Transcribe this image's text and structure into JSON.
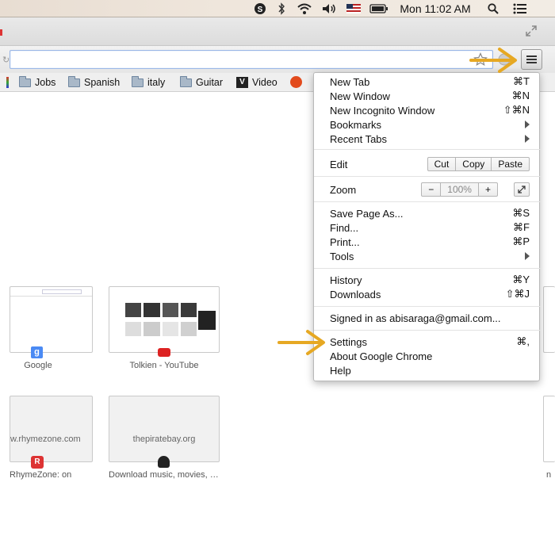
{
  "menubar": {
    "clock": "Mon 11:02 AM"
  },
  "bookmarks": [
    {
      "label": "Jobs"
    },
    {
      "label": "Spanish"
    },
    {
      "label": "italy"
    },
    {
      "label": "Guitar"
    },
    {
      "label": "Video"
    }
  ],
  "thumbnails": [
    {
      "label": "Google"
    },
    {
      "label": "Tolkien - YouTube"
    },
    {
      "label": "RhymeZone: on",
      "site": "w.rhymezone.com"
    },
    {
      "label": "Download music, movies, …",
      "site": "thepiratebay.org"
    },
    {
      "label": "n"
    }
  ],
  "menu": {
    "new_tab": {
      "label": "New Tab",
      "shortcut": "⌘T"
    },
    "new_window": {
      "label": "New Window",
      "shortcut": "⌘N"
    },
    "new_incognito": {
      "label": "New Incognito Window",
      "shortcut": "⇧⌘N"
    },
    "bookmarks": {
      "label": "Bookmarks"
    },
    "recent_tabs": {
      "label": "Recent Tabs"
    },
    "edit": {
      "label": "Edit",
      "cut": "Cut",
      "copy": "Copy",
      "paste": "Paste"
    },
    "zoom": {
      "label": "Zoom",
      "minus": "−",
      "value": "100%",
      "plus": "+"
    },
    "save_page": {
      "label": "Save Page As...",
      "shortcut": "⌘S"
    },
    "find": {
      "label": "Find...",
      "shortcut": "⌘F"
    },
    "print": {
      "label": "Print...",
      "shortcut": "⌘P"
    },
    "tools": {
      "label": "Tools"
    },
    "history": {
      "label": "History",
      "shortcut": "⌘Y"
    },
    "downloads": {
      "label": "Downloads",
      "shortcut": "⇧⌘J"
    },
    "signed_in": {
      "label": "Signed in as abisaraga@gmail.com..."
    },
    "settings": {
      "label": "Settings",
      "shortcut": "⌘,"
    },
    "about": {
      "label": "About Google Chrome"
    },
    "help": {
      "label": "Help"
    }
  },
  "colors": {
    "annotation_arrow": "#e6a823"
  }
}
